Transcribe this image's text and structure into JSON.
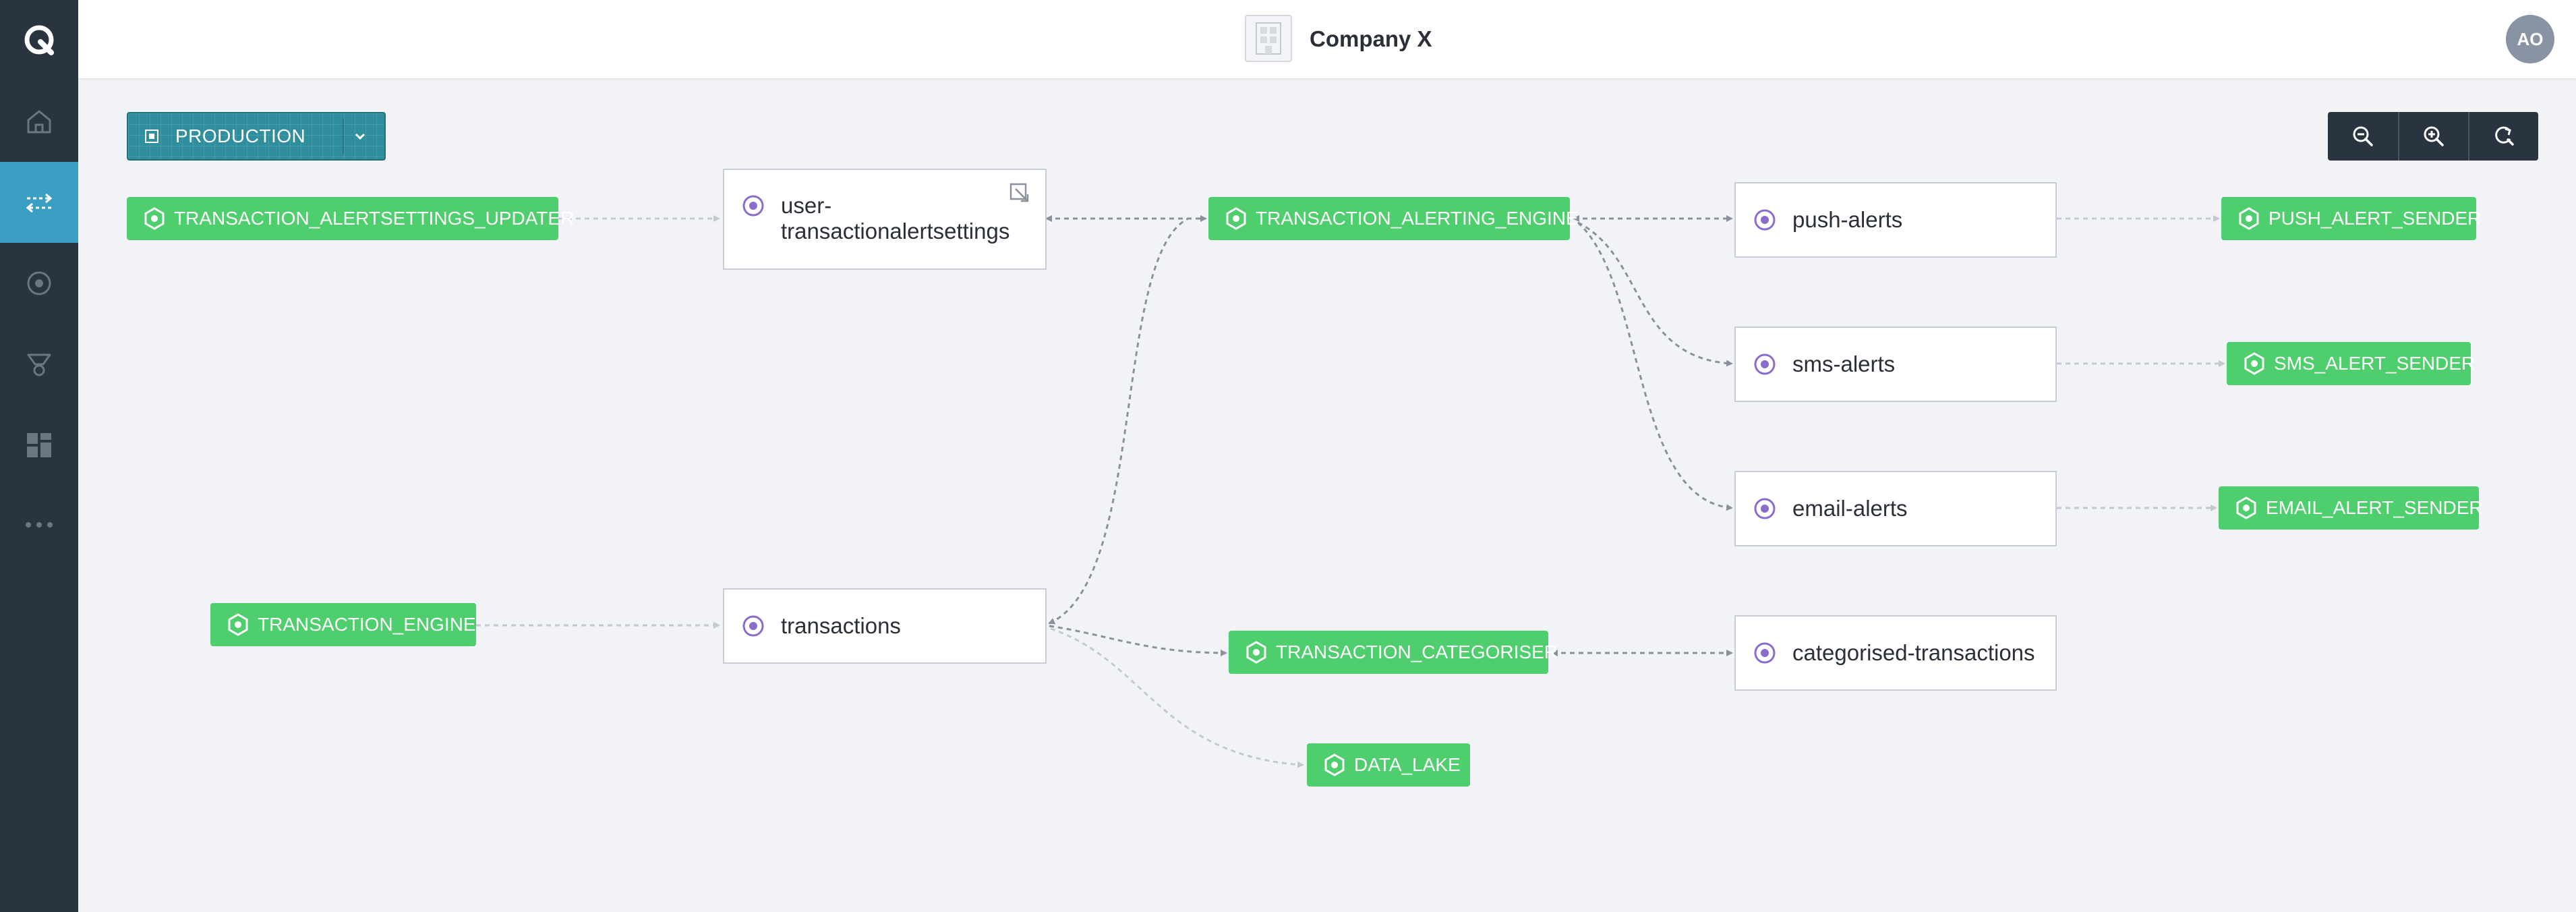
{
  "header": {
    "company_name": "Company X",
    "avatar_initials": "AO"
  },
  "sidebar": {
    "items": [
      {
        "icon": "logo-icon"
      },
      {
        "icon": "home-icon"
      },
      {
        "icon": "topology-icon",
        "active": true
      },
      {
        "icon": "topics-icon"
      },
      {
        "icon": "applications-icon"
      },
      {
        "icon": "dashboard-icon"
      },
      {
        "icon": "more-icon"
      }
    ]
  },
  "toolbar": {
    "environment": "PRODUCTION",
    "zoom_buttons": [
      "zoom-out-icon",
      "zoom-in-icon",
      "reset-zoom-icon"
    ]
  },
  "colors": {
    "sidebar": "#2a3440",
    "sidebar_active": "#3a9fc2",
    "application_node": "#4fce6d",
    "topic_icon": "#8b6bcc",
    "environment": "#2e8e9e",
    "edge": "#8d93a0"
  },
  "graph": {
    "applications": {
      "settings_updater": "TRANSACTION_ALERTSETTINGS_UPDATER",
      "alerting_engine": "TRANSACTION_ALERTING_ENGINE",
      "push_sender": "PUSH_ALERT_SENDER",
      "sms_sender": "SMS_ALERT_SENDER",
      "email_sender": "EMAIL_ALERT_SENDER",
      "transaction_engine": "TRANSACTION_ENGINE",
      "categoriser": "TRANSACTION_CATEGORISER",
      "data_lake": "DATA_LAKE"
    },
    "topics": {
      "user_settings_line1": "user-",
      "user_settings_line2": "transactionalertsettings",
      "push_alerts": "push-alerts",
      "sms_alerts": "sms-alerts",
      "email_alerts": "email-alerts",
      "transactions": "transactions",
      "categorised": "categorised-transactions"
    }
  }
}
